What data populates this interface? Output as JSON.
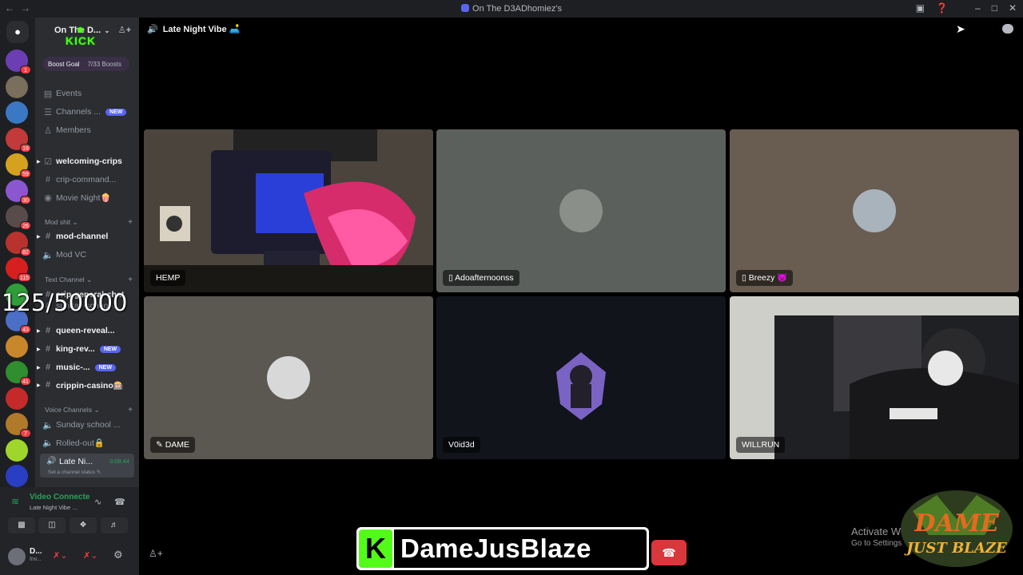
{
  "window": {
    "title": "On The D3ADhomiez's"
  },
  "server": {
    "name": "On The D...",
    "kick_logo_text": "KICK",
    "boost_goal_label": "Boost Goal",
    "boost_progress": "7/33 Boosts"
  },
  "nav": [
    {
      "label": "Events",
      "icon": "calendar-icon"
    },
    {
      "label": "Channels ...",
      "icon": "channels-icon",
      "badge": "NEW"
    },
    {
      "label": "Members",
      "icon": "members-icon"
    }
  ],
  "channels_top": [
    {
      "label": "welcoming-crips",
      "icon": "rules-icon",
      "bright": true
    },
    {
      "label": "crip-command...",
      "icon": "hash-icon"
    },
    {
      "label": "Movie Night🍿",
      "icon": "stage-icon"
    }
  ],
  "category_mod": "Mod shit",
  "channels_mod": [
    {
      "label": "mod-channel",
      "icon": "hash-icon",
      "bright": true
    },
    {
      "label": "Mod VC",
      "icon": "speaker-icon"
    }
  ],
  "category_text": "Text Channel",
  "channels_text": [
    {
      "label": "crip-general-chat",
      "icon": "hash-icon",
      "bright": true
    },
    {
      "label": "sunday-school-...",
      "icon": "hash-icon"
    },
    {
      "label": "queen-reveal...",
      "icon": "hash-icon",
      "bright": true
    },
    {
      "label": "king-rev...",
      "icon": "hash-icon",
      "bright": true,
      "badge": "NEW"
    },
    {
      "label": "music-...",
      "icon": "hash-icon",
      "bright": true,
      "badge": "NEW"
    },
    {
      "label": "crippin-casino🎰",
      "icon": "hash-icon",
      "bright": true
    }
  ],
  "category_voice": "Voice Channels",
  "channels_voice": [
    {
      "label": "Sunday school ...",
      "icon": "speaker-icon"
    },
    {
      "label": "Rolled-out🔒",
      "icon": "speaker-icon"
    }
  ],
  "active_voice": {
    "name": "Late Ni...",
    "time": "3:08:44",
    "status": "Set a channel status ✎"
  },
  "overlay_count": "125/50000",
  "voice_panel": {
    "title": "Video Connecte",
    "subtitle": "Late Night Vibe ..."
  },
  "user_panel": {
    "name": "D...",
    "status": "Inv..."
  },
  "stage": {
    "channel_name": "Late Night Vibe 🛋️"
  },
  "tiles": [
    {
      "name": "HEMP"
    },
    {
      "name": "Adoafternoonss",
      "mobile": true
    },
    {
      "name": "Breezy 👿",
      "mobile": true
    },
    {
      "name": "DAME",
      "icon": "pen-icon"
    },
    {
      "name": "V0id3d"
    },
    {
      "name": "WILLRUN"
    }
  ],
  "overlays": {
    "activate_title": "Activate W",
    "activate_sub": "Go to Settings",
    "brand_k": "K",
    "brand_name": "DameJusBlaze",
    "dame_logo_line1": "DAME",
    "dame_logo_line2": "JUST BLAZE"
  },
  "server_badges": [
    "1",
    "",
    "",
    "19",
    "59",
    "30",
    "26",
    "82",
    "115",
    "",
    "43",
    "",
    "41",
    "",
    "7",
    "",
    ""
  ],
  "colors": {
    "kick_green": "#53fc18",
    "discord_blurple": "#5865f2",
    "voice_green": "#23a55a",
    "danger_red": "#da373c"
  }
}
